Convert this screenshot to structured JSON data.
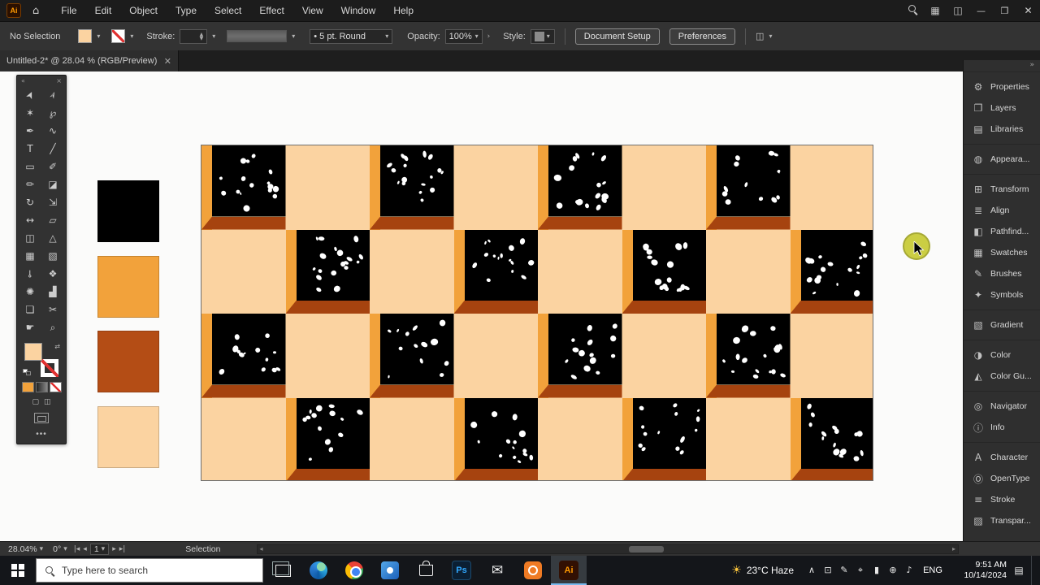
{
  "app": {
    "menu": {
      "logo": "Ai",
      "items": [
        "File",
        "Edit",
        "Object",
        "Type",
        "Select",
        "Effect",
        "View",
        "Window",
        "Help"
      ]
    },
    "control_bar": {
      "no_selection": "No Selection",
      "stroke_label": "Stroke:",
      "brush_bullet": "•",
      "brush_name": "5 pt. Round",
      "opacity_label": "Opacity:",
      "opacity_value": "100%",
      "style_label": "Style:",
      "document_setup": "Document Setup",
      "preferences": "Preferences"
    },
    "tab_title": "Untitled-2* @ 28.04 % (RGB/Preview)"
  },
  "toolbar": {
    "tools": [
      {
        "name": "selection-tool",
        "glyph": "➤",
        "rot": -65
      },
      {
        "name": "direct-selection-tool",
        "glyph": "➢",
        "rot": -65
      },
      {
        "name": "magic-wand-tool",
        "glyph": "✶"
      },
      {
        "name": "lasso-tool",
        "glyph": "℘"
      },
      {
        "name": "pen-tool",
        "glyph": "✒"
      },
      {
        "name": "curvature-tool",
        "glyph": "∿"
      },
      {
        "name": "type-tool",
        "glyph": "T"
      },
      {
        "name": "line-segment-tool",
        "glyph": "╱"
      },
      {
        "name": "rectangle-tool",
        "glyph": "▭"
      },
      {
        "name": "paintbrush-tool",
        "glyph": "✐"
      },
      {
        "name": "pencil-tool",
        "glyph": "✏"
      },
      {
        "name": "eraser-tool",
        "glyph": "◪"
      },
      {
        "name": "rotate-tool",
        "glyph": "↻"
      },
      {
        "name": "scale-tool",
        "glyph": "⇲"
      },
      {
        "name": "width-tool",
        "glyph": "↔"
      },
      {
        "name": "free-transform-tool",
        "glyph": "▱"
      },
      {
        "name": "shape-builder-tool",
        "glyph": "◫"
      },
      {
        "name": "perspective-grid-tool",
        "glyph": "△"
      },
      {
        "name": "mesh-tool",
        "glyph": "▦"
      },
      {
        "name": "gradient-tool",
        "glyph": "▧"
      },
      {
        "name": "eyedropper-tool",
        "glyph": "⊸",
        "rot": 90
      },
      {
        "name": "blend-tool",
        "glyph": "❖"
      },
      {
        "name": "symbol-sprayer-tool",
        "glyph": "✺"
      },
      {
        "name": "column-graph-tool",
        "glyph": "▟"
      },
      {
        "name": "artboard-tool",
        "glyph": "❏"
      },
      {
        "name": "slice-tool",
        "glyph": "✂"
      },
      {
        "name": "hand-tool",
        "glyph": "☛"
      },
      {
        "name": "zoom-tool",
        "glyph": "⌕"
      }
    ]
  },
  "artwork": {
    "swatches": [
      {
        "name": "black",
        "color": "#000000"
      },
      {
        "name": "orange",
        "color": "#F2A23B"
      },
      {
        "name": "dark-orange",
        "color": "#B44D15"
      },
      {
        "name": "peach",
        "color": "#FBD3A1"
      }
    ],
    "grid": {
      "rows": 4,
      "cols": 8,
      "cell": 103.5,
      "row_offsets": [
        0,
        1,
        0,
        1
      ]
    },
    "colors": {
      "background": "#FBD3A1",
      "tile": "#000000",
      "edge_left": "#F2A23B",
      "edge_bottom": "#A6430F",
      "dot": "#FFFFFF"
    }
  },
  "dock": {
    "collapse_glyph": "»",
    "groups": [
      {
        "items": [
          {
            "name": "properties",
            "label": "Properties",
            "glyph": "⚙"
          },
          {
            "name": "layers",
            "label": "Layers",
            "glyph": "❐"
          },
          {
            "name": "libraries",
            "label": "Libraries",
            "glyph": "▤"
          }
        ]
      },
      {
        "items": [
          {
            "name": "appearance",
            "label": "Appeara...",
            "glyph": "◍"
          }
        ]
      },
      {
        "items": [
          {
            "name": "transform",
            "label": "Transform",
            "glyph": "⊞"
          },
          {
            "name": "align",
            "label": "Align",
            "glyph": "≣"
          },
          {
            "name": "pathfinder",
            "label": "Pathfind...",
            "glyph": "◧"
          },
          {
            "name": "swatches",
            "label": "Swatches",
            "glyph": "▦"
          },
          {
            "name": "brushes",
            "label": "Brushes",
            "glyph": "✎"
          },
          {
            "name": "symbols",
            "label": "Symbols",
            "glyph": "✦"
          }
        ]
      },
      {
        "items": [
          {
            "name": "gradient",
            "label": "Gradient",
            "glyph": "▧"
          }
        ]
      },
      {
        "items": [
          {
            "name": "color",
            "label": "Color",
            "glyph": "◑"
          },
          {
            "name": "color-guide",
            "label": "Color Gu...",
            "glyph": "◭"
          }
        ]
      },
      {
        "items": [
          {
            "name": "navigator",
            "label": "Navigator",
            "glyph": "◎"
          },
          {
            "name": "info",
            "label": "Info",
            "glyph": "ⓘ"
          }
        ]
      },
      {
        "items": [
          {
            "name": "character",
            "label": "Character",
            "glyph": "A"
          },
          {
            "name": "opentype",
            "label": "OpenType",
            "glyph": "Ⓞ"
          },
          {
            "name": "stroke-panel",
            "label": "Stroke",
            "glyph": "≡"
          },
          {
            "name": "transparency",
            "label": "Transpar...",
            "glyph": "▨"
          }
        ]
      }
    ]
  },
  "status_bar": {
    "zoom": "28.04%",
    "rotation": "0°",
    "artboard_number": "1",
    "tool_name": "Selection"
  },
  "taskbar": {
    "search_placeholder": "Type here to search",
    "apps": [
      {
        "name": "task-view",
        "kind": "taskview"
      },
      {
        "name": "edge",
        "kind": "edge"
      },
      {
        "name": "chrome",
        "kind": "chrome"
      },
      {
        "name": "photos",
        "kind": "blueapp"
      },
      {
        "name": "store",
        "kind": "store"
      },
      {
        "name": "photoshop",
        "kind": "ps",
        "label": "Ps"
      },
      {
        "name": "mail",
        "kind": "mail",
        "glyph": "✉"
      },
      {
        "name": "screen-recorder",
        "kind": "recorder"
      },
      {
        "name": "illustrator",
        "kind": "ai",
        "label": "Ai",
        "active": true
      }
    ],
    "tray": {
      "weather": "23°C Haze",
      "weather_icon": "☀",
      "icons": [
        {
          "name": "hidden-icons-chevron",
          "glyph": "∧"
        },
        {
          "name": "display-icon",
          "glyph": "⊡"
        },
        {
          "name": "pen-icon",
          "glyph": "✎"
        },
        {
          "name": "mic-icon",
          "glyph": "⌖"
        },
        {
          "name": "battery-icon",
          "glyph": "▮"
        },
        {
          "name": "network-icon",
          "glyph": "⊕"
        },
        {
          "name": "volume-icon",
          "glyph": "♪"
        }
      ],
      "language": "ENG",
      "time": "9:51 AM",
      "date": "10/14/2024"
    }
  }
}
